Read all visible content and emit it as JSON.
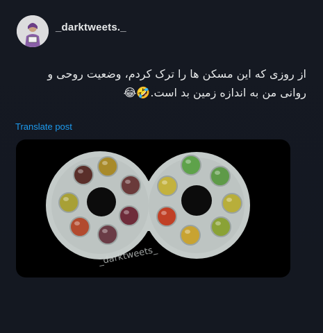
{
  "post": {
    "username": "_darktweets._",
    "text_lines": [
      "از روزی که این مسکن ها را ترک کردم، وضعیت روحی و",
      "روانی من به اندازه زمین بد است.🤣😂"
    ],
    "translate_label": "Translate post",
    "media": {
      "watermark": "_darktweets_",
      "pill_colors": {
        "left": [
          "#5a2f2a",
          "#a88a2a",
          "#6a3a3a",
          "#a8a036",
          "#6e2c3a",
          "#b24a2e",
          "#6a3c46"
        ],
        "right": [
          "#5ea24a",
          "#5e9a48",
          "#c3b23e",
          "#b8ae3a",
          "#c04026",
          "#8aa236",
          "#c8a332"
        ]
      }
    }
  }
}
